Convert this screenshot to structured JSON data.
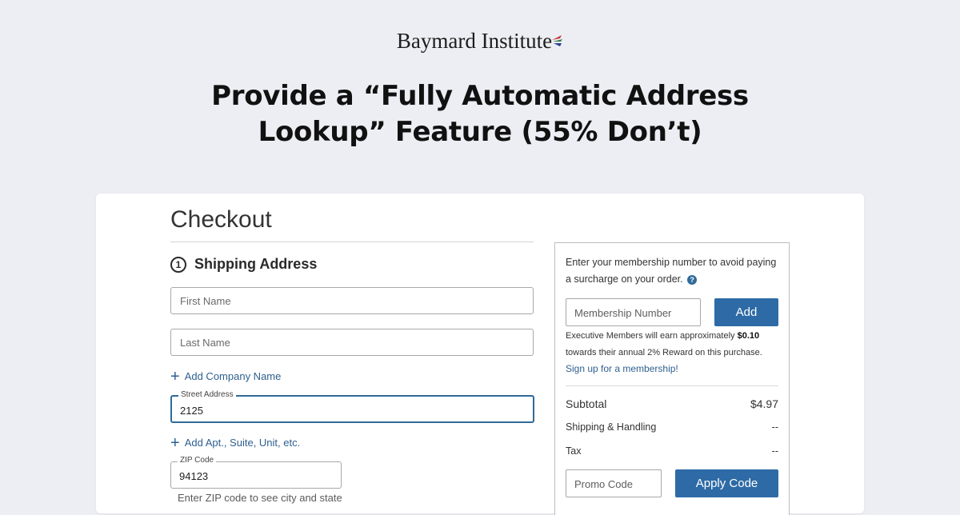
{
  "brand": {
    "name": "Baymard Institute"
  },
  "headline": {
    "line1": "Provide a “Fully Automatic Address",
    "line2": "Lookup” Feature (55% Don’t)"
  },
  "checkout": {
    "title": "Checkout",
    "section": {
      "number": "1",
      "title": "Shipping Address"
    },
    "fields": {
      "first_name_placeholder": "First Name",
      "last_name_placeholder": "Last Name",
      "street_label": "Street Address",
      "street_value": "2125",
      "zip_label": "ZIP Code",
      "zip_value": "94123"
    },
    "add_company_label": "Add Company Name",
    "add_apt_label": "Add Apt., Suite, Unit, etc.",
    "zip_helper": "Enter ZIP code to see city and state"
  },
  "summary": {
    "membership_message": "Enter your membership number to avoid paying a surcharge on your order.",
    "help_icon": "?",
    "membership_placeholder": "Membership Number",
    "add_button": "Add",
    "exec_text_before": "Executive Members will earn approximately ",
    "exec_amount": "$0.10",
    "exec_text_after": " towards their annual 2% Reward on this purchase. ",
    "signup_link": "Sign up for a membership!",
    "rows": [
      {
        "label": "Subtotal",
        "value": "$4.97"
      },
      {
        "label": "Shipping & Handling",
        "value": "--"
      },
      {
        "label": "Tax",
        "value": "--"
      }
    ],
    "promo_placeholder": "Promo Code",
    "apply_button": "Apply Code"
  },
  "colors": {
    "background": "#edeef3",
    "accent_blue": "#2e6ba6",
    "link_blue": "#2e5f8f"
  }
}
